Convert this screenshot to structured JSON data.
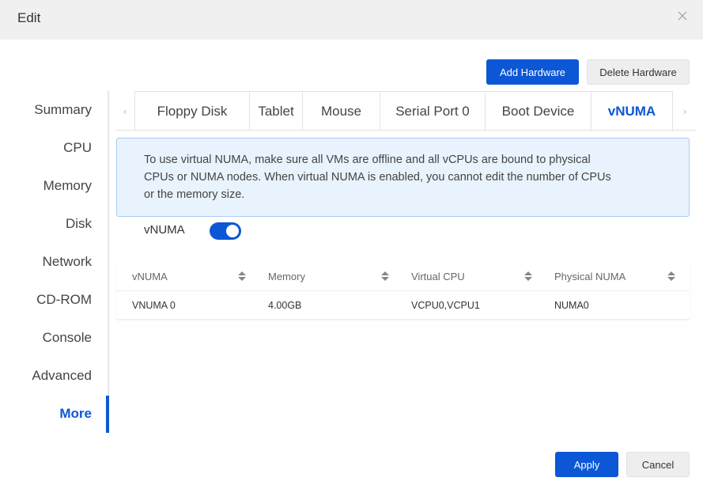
{
  "dialog": {
    "title": "Edit"
  },
  "toolbar": {
    "add_hardware": "Add Hardware",
    "delete_hardware": "Delete Hardware"
  },
  "sidebar": {
    "items": [
      {
        "label": "Summary"
      },
      {
        "label": "CPU"
      },
      {
        "label": "Memory"
      },
      {
        "label": "Disk"
      },
      {
        "label": "Network"
      },
      {
        "label": "CD-ROM"
      },
      {
        "label": "Console"
      },
      {
        "label": "Advanced"
      },
      {
        "label": "More",
        "active": true
      }
    ]
  },
  "tabs": [
    {
      "label": "Floppy Disk"
    },
    {
      "label": "Tablet"
    },
    {
      "label": "Mouse"
    },
    {
      "label": "Serial Port 0"
    },
    {
      "label": "Boot Device"
    },
    {
      "label": "vNUMA",
      "active": true
    }
  ],
  "notice": {
    "text": "To use virtual NUMA, make sure all VMs are offline and all vCPUs are bound to physical CPUs or NUMA nodes. When virtual NUMA is enabled, you cannot edit the number of CPUs or the memory size."
  },
  "vnuma_switch": {
    "label": "vNUMA",
    "enabled": true
  },
  "table": {
    "headers": [
      "vNUMA",
      "Memory",
      "Virtual CPU",
      "Physical NUMA"
    ],
    "rows": [
      [
        "VNUMA 0",
        "4.00GB",
        "VCPU0,VCPU1",
        "NUMA0"
      ]
    ]
  },
  "footer": {
    "apply": "Apply",
    "cancel": "Cancel"
  },
  "colors": {
    "accent": "#0c57d6",
    "notice_bg": "#e9f3fd",
    "notice_border": "#a9cdf0"
  },
  "icons": {
    "close": "close-icon",
    "sort": "sort-icon",
    "tab_prev": "chevron-left-icon",
    "tab_next": "chevron-right-icon"
  }
}
